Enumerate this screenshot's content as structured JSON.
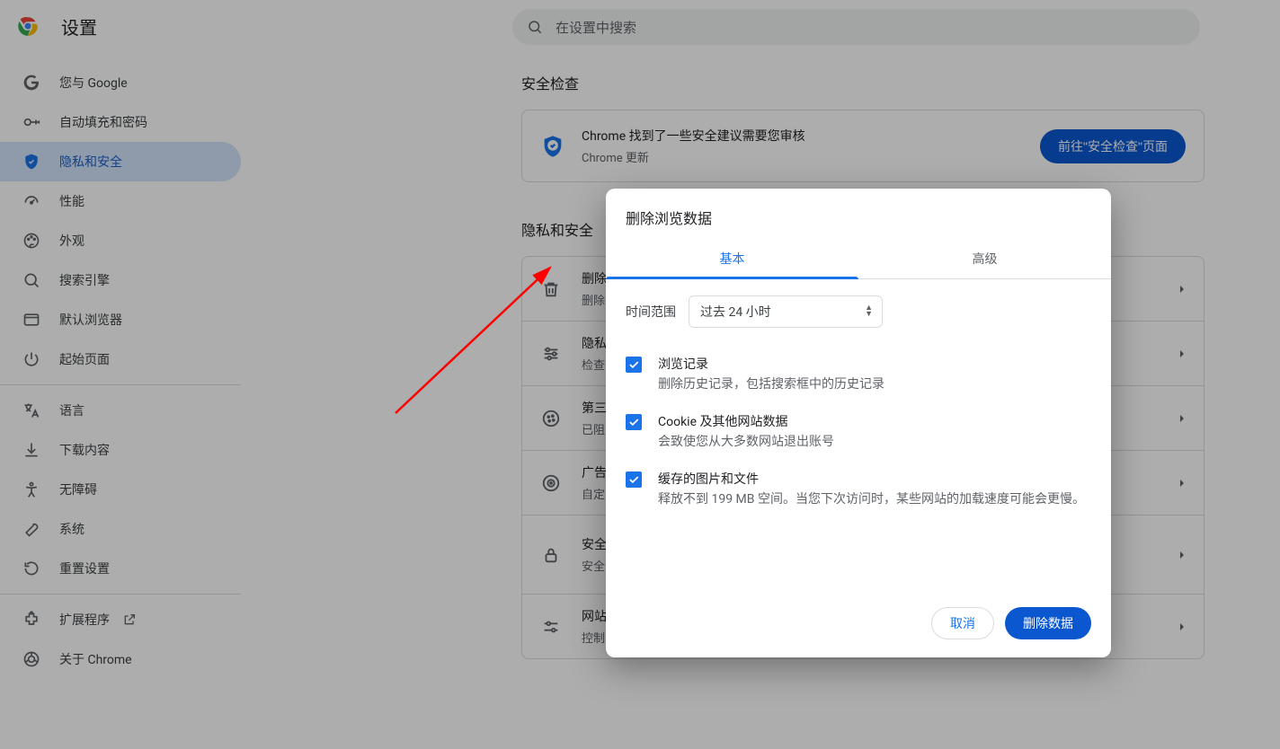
{
  "header": {
    "title": "设置"
  },
  "search": {
    "placeholder": "在设置中搜索"
  },
  "sidebar": {
    "items": [
      {
        "label": "您与 Google"
      },
      {
        "label": "自动填充和密码"
      },
      {
        "label": "隐私和安全"
      },
      {
        "label": "性能"
      },
      {
        "label": "外观"
      },
      {
        "label": "搜索引擎"
      },
      {
        "label": "默认浏览器"
      },
      {
        "label": "起始页面"
      }
    ],
    "items2": [
      {
        "label": "语言"
      },
      {
        "label": "下载内容"
      },
      {
        "label": "无障碍"
      },
      {
        "label": "系统"
      },
      {
        "label": "重置设置"
      }
    ],
    "items3": [
      {
        "label": "扩展程序"
      },
      {
        "label": "关于 Chrome"
      }
    ]
  },
  "main": {
    "safety_section": "安全检查",
    "safety_card": {
      "title": "Chrome 找到了一些安全建议需要您审核",
      "sub": "Chrome 更新",
      "button": "前往\"安全检查\"页面"
    },
    "privacy_section": "隐私和安全",
    "rows": [
      {
        "title": "删除",
        "sub": "删除"
      },
      {
        "title": "隐私",
        "sub": "检查"
      },
      {
        "title": "第三",
        "sub": "已阻"
      },
      {
        "title": "广告",
        "sub": "自定"
      },
      {
        "title": "安全",
        "sub": "安全"
      },
      {
        "title": "网站",
        "sub": "控制"
      }
    ]
  },
  "dialog": {
    "title": "删除浏览数据",
    "tabs": {
      "basic": "基本",
      "advanced": "高级"
    },
    "time_label": "时间范围",
    "time_value": "过去 24 小时",
    "options": [
      {
        "title": "浏览记录",
        "sub": "删除历史记录，包括搜索框中的历史记录"
      },
      {
        "title": "Cookie 及其他网站数据",
        "sub": "会致使您从大多数网站退出账号"
      },
      {
        "title": "缓存的图片和文件",
        "sub": "释放不到 199 MB 空间。当您下次访问时，某些网站的加载速度可能会更慢。"
      }
    ],
    "cancel": "取消",
    "confirm": "删除数据"
  }
}
